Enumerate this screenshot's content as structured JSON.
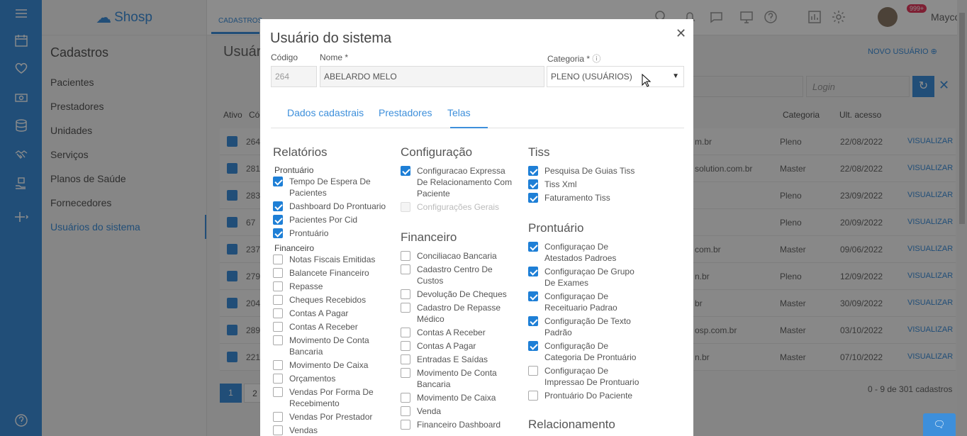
{
  "app": {
    "name": "Shosp"
  },
  "sidebar": {
    "title": "Cadastros",
    "items": [
      {
        "label": "Pacientes"
      },
      {
        "label": "Prestadores"
      },
      {
        "label": "Unidades"
      },
      {
        "label": "Serviços"
      },
      {
        "label": "Planos de Saúde"
      },
      {
        "label": "Fornecedores"
      },
      {
        "label": "Usuários do sistema"
      }
    ]
  },
  "topbar": {
    "tab": "CADASTROS",
    "badge": "999+",
    "user": "Maycon"
  },
  "page": {
    "title": "Usuár",
    "new_user": "NOVO USUÁRIO",
    "login_placeholder": "Login",
    "headers": {
      "ativo": "Ativo",
      "codigo": "Cód",
      "categoria": "Categoria",
      "ult_acesso": "Ult. acesso"
    },
    "rows": [
      {
        "cod": "264",
        "email": "m.br",
        "cat": "Pleno",
        "acc": "22/08/2022",
        "action": "VISUALIZAR"
      },
      {
        "cod": "281",
        "email": "solution.com.br",
        "cat": "Master",
        "acc": "22/08/2022",
        "action": "VISUALIZAR"
      },
      {
        "cod": "283",
        "email": "",
        "cat": "Pleno",
        "acc": "23/09/2022",
        "action": "VISUALIZAR"
      },
      {
        "cod": "67",
        "email": "",
        "cat": "Pleno",
        "acc": "20/09/2022",
        "action": "VISUALIZAR"
      },
      {
        "cod": "237",
        "email": "com.br",
        "cat": "Master",
        "acc": "09/06/2022",
        "action": "VISUALIZAR"
      },
      {
        "cod": "279",
        "email": "n.br",
        "cat": "Pleno",
        "acc": "12/09/2022",
        "action": "VISUALIZAR"
      },
      {
        "cod": "204",
        "email": "br",
        "cat": "Master",
        "acc": "30/09/2022",
        "action": "VISUALIZAR"
      },
      {
        "cod": "289",
        "email": "osp.com.br",
        "cat": "Master",
        "acc": "03/10/2022",
        "action": "VISUALIZAR"
      },
      {
        "cod": "221",
        "email": "n.br",
        "cat": "Master",
        "acc": "07/10/2022",
        "action": "VISUALIZAR"
      }
    ],
    "pages": [
      "1",
      "2"
    ],
    "count": "0 - 9 de 301 cadastros"
  },
  "modal": {
    "title": "Usuário do sistema",
    "codigo_label": "Código",
    "codigo_value": "264",
    "nome_label": "Nome *",
    "nome_value": "ABELARDO MELO",
    "categoria_label": "Categoria *",
    "categoria_value": "PLENO (USUÁRIOS)",
    "tabs": [
      "Dados cadastrais",
      "Prestadores",
      "Telas"
    ],
    "col1": {
      "title": "Relatórios",
      "sub1": "Prontuário",
      "items1": [
        {
          "label": "Tempo De Espera De Pacientes",
          "checked": true
        },
        {
          "label": "Dashboard Do Prontuario",
          "checked": true
        },
        {
          "label": "Pacientes Por Cid",
          "checked": true
        },
        {
          "label": "Prontuário",
          "checked": true
        }
      ],
      "sub2": "Financeiro",
      "items2": [
        {
          "label": "Notas Fiscais Emitidas",
          "checked": false
        },
        {
          "label": "Balancete Financeiro",
          "checked": false
        },
        {
          "label": "Repasse",
          "checked": false
        },
        {
          "label": "Cheques Recebidos",
          "checked": false
        },
        {
          "label": "Contas A Pagar",
          "checked": false
        },
        {
          "label": "Contas A Receber",
          "checked": false
        },
        {
          "label": "Movimento De Conta Bancaria",
          "checked": false
        },
        {
          "label": "Movimento De Caixa",
          "checked": false
        },
        {
          "label": "Orçamentos",
          "checked": false
        },
        {
          "label": "Vendas Por Forma De Recebimento",
          "checked": false
        },
        {
          "label": "Vendas Por Prestador",
          "checked": false
        },
        {
          "label": "Vendas",
          "checked": false
        }
      ]
    },
    "col2": {
      "title1": "Configuração",
      "items1": [
        {
          "label": "Configuracao Expressa De Relacionamento Com Paciente",
          "checked": true,
          "disabled": false
        },
        {
          "label": "Configurações Gerais",
          "checked": false,
          "disabled": true
        }
      ],
      "title2": "Financeiro",
      "items2": [
        {
          "label": "Conciliacao Bancaria",
          "checked": false
        },
        {
          "label": "Cadastro Centro De Custos",
          "checked": false
        },
        {
          "label": "Devolução De Cheques",
          "checked": false
        },
        {
          "label": "Cadastro De Repasse Médico",
          "checked": false
        },
        {
          "label": "Contas A Receber",
          "checked": false
        },
        {
          "label": "Contas A Pagar",
          "checked": false
        },
        {
          "label": "Entradas E Saídas",
          "checked": false
        },
        {
          "label": "Movimento De Conta Bancaria",
          "checked": false
        },
        {
          "label": "Movimento De Caixa",
          "checked": false
        },
        {
          "label": "Venda",
          "checked": false
        },
        {
          "label": "Financeiro Dashboard",
          "checked": false
        }
      ]
    },
    "col3": {
      "title1": "Tiss",
      "items1": [
        {
          "label": "Pesquisa De Guias Tiss",
          "checked": true
        },
        {
          "label": "Tiss Xml",
          "checked": true
        },
        {
          "label": "Faturamento Tiss",
          "checked": true
        }
      ],
      "title2": "Prontuário",
      "items2": [
        {
          "label": "Configuraçao De Atestados Padroes",
          "checked": true
        },
        {
          "label": "Configuraçao De Grupo De Exames",
          "checked": true
        },
        {
          "label": "Configuraçao De Receituario Padrao",
          "checked": true
        },
        {
          "label": "Configuração De Texto Padrão",
          "checked": true
        },
        {
          "label": "Configuração De Categoria De Prontuário",
          "checked": true
        },
        {
          "label": "Configuraçao De Impressao De Prontuario",
          "checked": false
        },
        {
          "label": "Prontuário Do Paciente",
          "checked": false
        }
      ],
      "title3": "Relacionamento"
    }
  }
}
